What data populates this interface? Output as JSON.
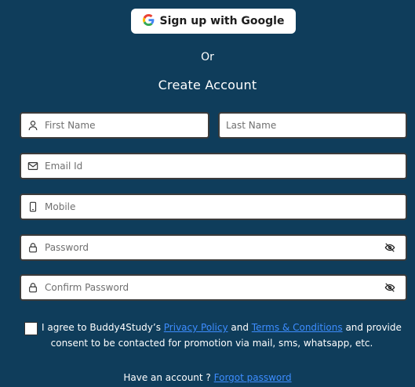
{
  "google_button": {
    "label": "Sign up with Google",
    "icon": "google-icon"
  },
  "or_text": "Or",
  "title": "Create Account",
  "fields": {
    "first_name": {
      "placeholder": "First Name",
      "value": "",
      "icon": "person-icon"
    },
    "last_name": {
      "placeholder": "Last Name",
      "value": ""
    },
    "email": {
      "placeholder": "Email Id",
      "value": "",
      "icon": "mail-icon"
    },
    "mobile": {
      "placeholder": "Mobile",
      "value": "",
      "icon": "mobile-icon"
    },
    "password": {
      "placeholder": "Password",
      "value": "",
      "icon": "lock-icon",
      "toggle_icon": "eye-off-icon"
    },
    "confirm_password": {
      "placeholder": "Confirm Password",
      "value": "",
      "icon": "lock-icon",
      "toggle_icon": "eye-off-icon"
    }
  },
  "agreement": {
    "checked": false,
    "prefix": "I agree to Buddy4Study’s ",
    "privacy_link": "Privacy Policy",
    "and": " and ",
    "terms_link": "Terms & Conditions",
    "suffix": " and provide",
    "line2": "consent to be contacted for promotion via mail, sms, whatsapp, etc."
  },
  "footer": {
    "text": "Have an account ? ",
    "link": "Forgot password"
  },
  "colors": {
    "background": "#0f3d5b",
    "link": "#3d8dff",
    "button_bg": "#ffffff"
  }
}
